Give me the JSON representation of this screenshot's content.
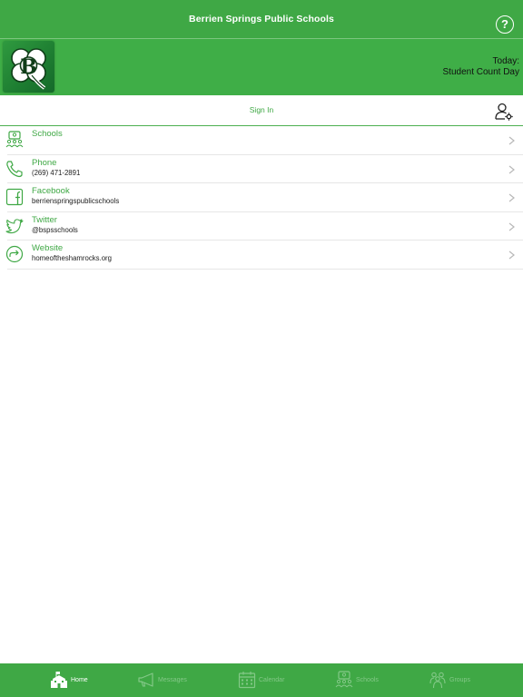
{
  "header": {
    "title": "Berrien Springs Public Schools",
    "help_label": "?"
  },
  "banner": {
    "today_label": "Today:",
    "today_event": "Student Count Day"
  },
  "signin": {
    "label": "Sign In"
  },
  "list": [
    {
      "label": "Schools",
      "sub": "",
      "icon": "schools-icon"
    },
    {
      "label": "Phone",
      "sub": "(269) 471-2891",
      "icon": "phone-icon"
    },
    {
      "label": "Facebook",
      "sub": "berrienspringspublicschools",
      "icon": "facebook-icon"
    },
    {
      "label": "Twitter",
      "sub": "@bspsschools",
      "icon": "twitter-icon"
    },
    {
      "label": "Website",
      "sub": "homeoftheshamrocks.org",
      "icon": "website-icon"
    }
  ],
  "tabs": [
    {
      "label": "Home",
      "active": true
    },
    {
      "label": "Messages",
      "active": false
    },
    {
      "label": "Calendar",
      "active": false
    },
    {
      "label": "Schools",
      "active": false
    },
    {
      "label": "Groups",
      "active": false
    }
  ],
  "colors": {
    "brand_green": "#3fa845",
    "inactive_tab": "#83c887"
  }
}
